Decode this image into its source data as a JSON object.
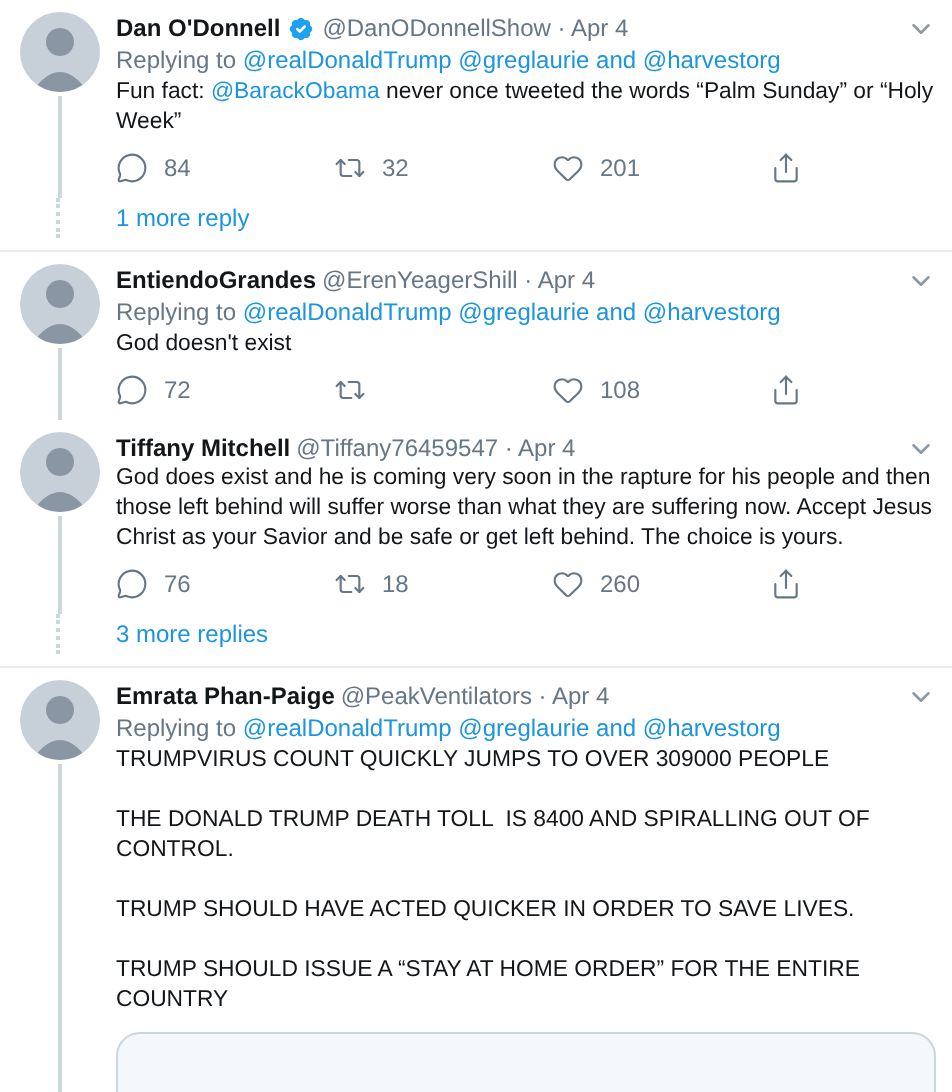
{
  "threads": [
    {
      "tweets": [
        {
          "name": "Dan O'Donnell",
          "verified": true,
          "meta": "@DanODonnellShow · Apr 4",
          "reply_label": "Replying to",
          "reply_targets": "@realDonaldTrump @greglaurie and @harvestorg",
          "body": [
            {
              "kind": "text",
              "text": "Fun fact: "
            },
            {
              "kind": "mention",
              "text": "@BarackObama"
            },
            {
              "kind": "text",
              "text": " never once tweeted the words “Palm Sunday” or “Holy Week”"
            }
          ],
          "replies": "84",
          "retweets": "32",
          "likes": "201"
        }
      ],
      "more": "1 more reply"
    },
    {
      "tweets": [
        {
          "name": "EntiendoGrandes",
          "verified": false,
          "meta": "@ErenYeagerShill · Apr 4",
          "reply_label": "Replying to",
          "reply_targets": "@realDonaldTrump @greglaurie and @harvestorg",
          "body": [
            {
              "kind": "text",
              "text": "God doesn't exist"
            }
          ],
          "replies": "72",
          "likes": "108"
        },
        {
          "name": "Tiffany Mitchell",
          "verified": false,
          "meta": "@Tiffany76459547 · Apr 4",
          "body": [
            {
              "kind": "text",
              "text": "God does exist and he is coming very soon in the rapture for his people and then those left behind will suffer worse than what they are suffering now. Accept Jesus Christ as your Savior and be safe or get left behind. The choice is yours."
            }
          ],
          "replies": "76",
          "retweets": "18",
          "likes": "260"
        }
      ],
      "more": "3 more replies"
    },
    {
      "tweets": [
        {
          "name": "Emrata Phan-Paige",
          "verified": false,
          "meta": "@PeakVentilators · Apr 4",
          "reply_label": "Replying to",
          "reply_targets": "@realDonaldTrump @greglaurie and @harvestorg",
          "body": [
            {
              "kind": "text",
              "text": "TRUMPVIRUS COUNT QUICKLY JUMPS TO OVER 309000 PEOPLE\n\nTHE DONALD TRUMP DEATH TOLL  IS 8400 AND SPIRALLING OUT OF CONTROL.\n\nTRUMP SHOULD HAVE ACTED QUICKER IN ORDER TO SAVE LIVES.\n\nTRUMP SHOULD ISSUE A “STAY AT HOME ORDER” FOR THE ENTIRE COUNTRY"
            }
          ],
          "has_card": true
        }
      ]
    }
  ]
}
